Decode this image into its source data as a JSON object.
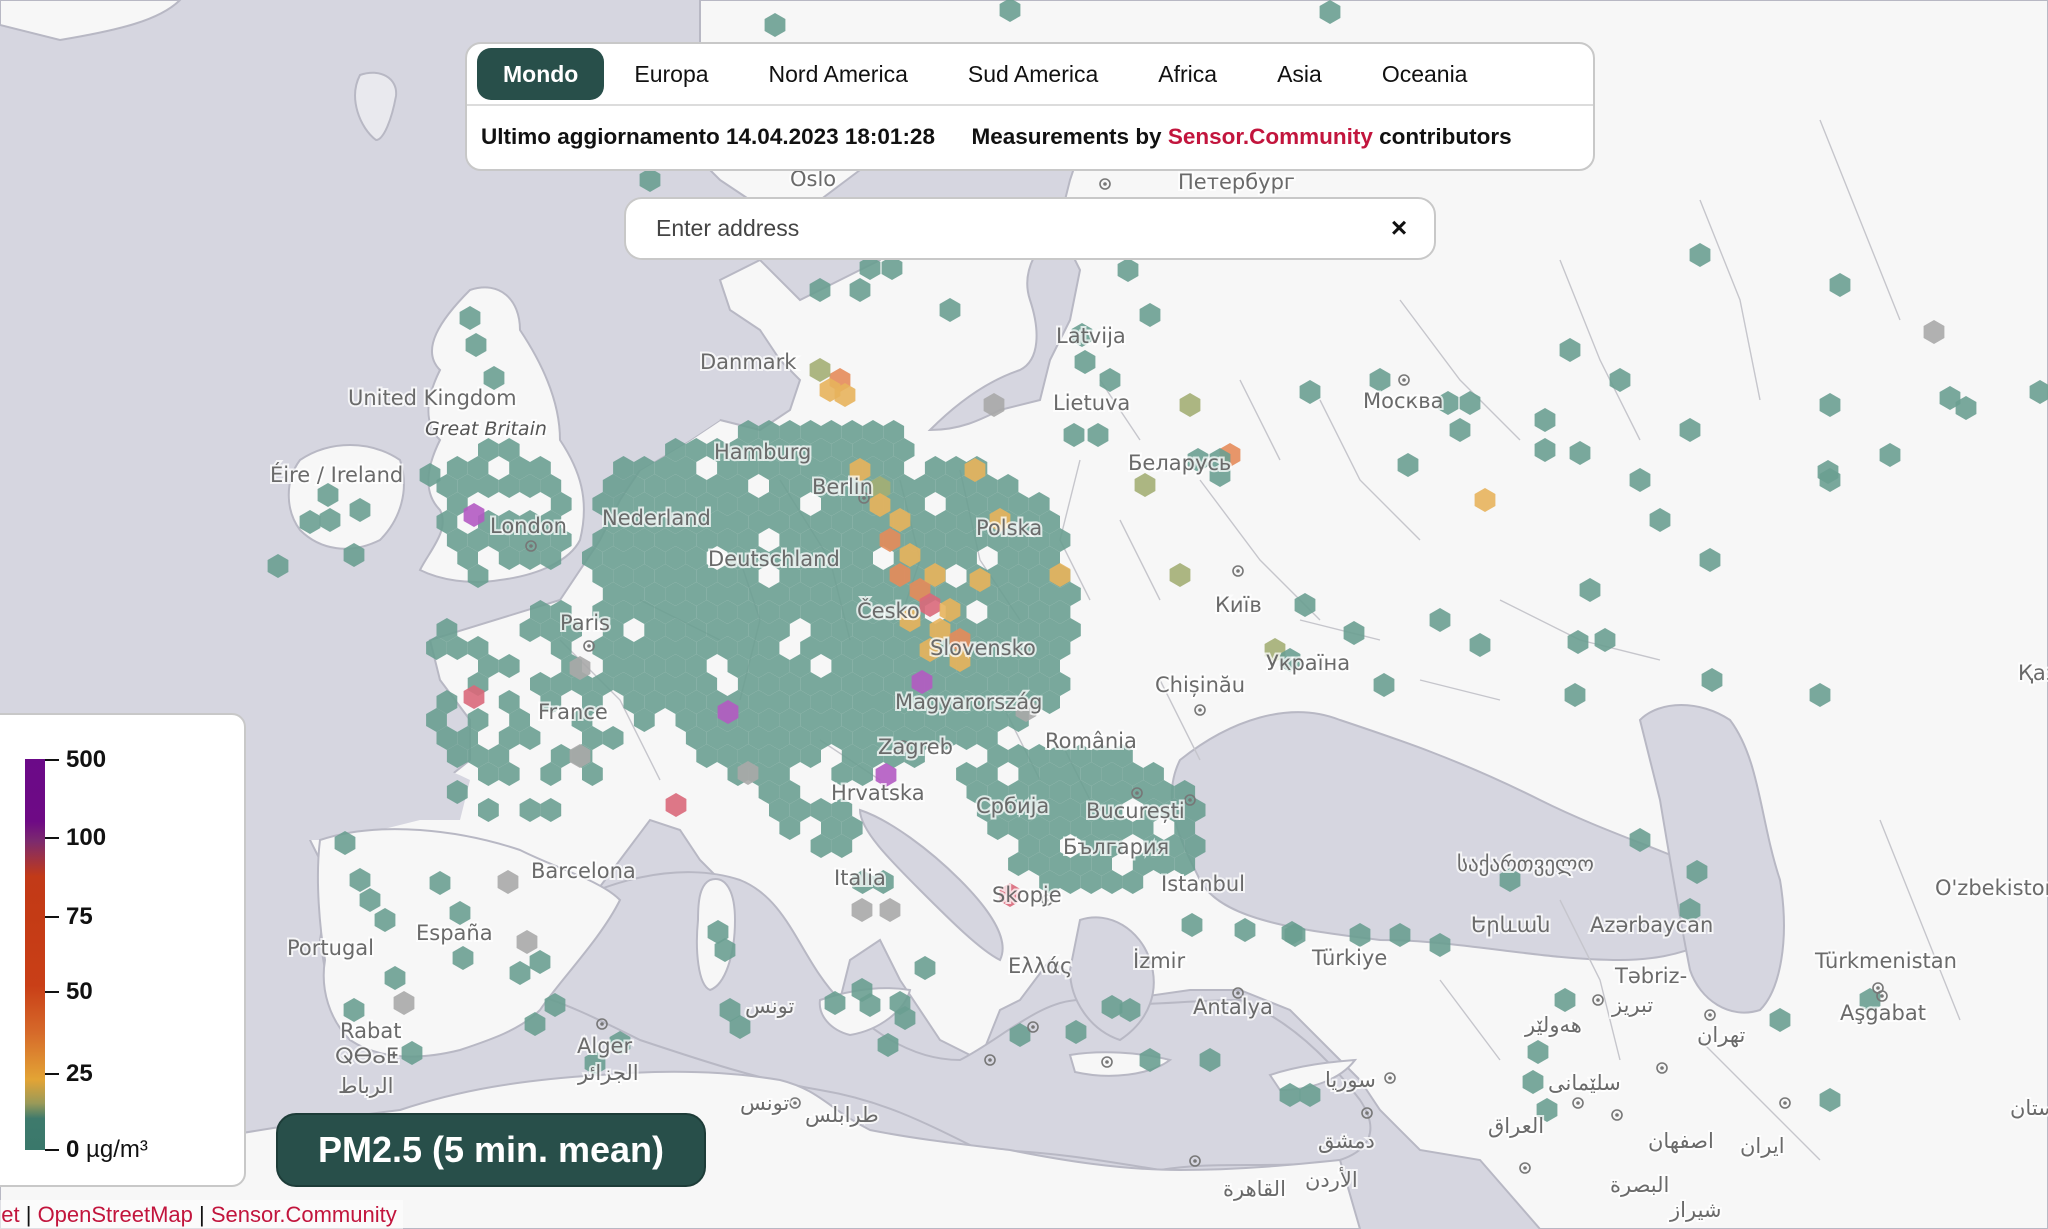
{
  "tabs": [
    {
      "label": "Mondo",
      "active": true
    },
    {
      "label": "Europa",
      "active": false
    },
    {
      "label": "Nord America",
      "active": false
    },
    {
      "label": "Sud America",
      "active": false
    },
    {
      "label": "Africa",
      "active": false
    },
    {
      "label": "Asia",
      "active": false
    },
    {
      "label": "Oceania",
      "active": false
    }
  ],
  "info": {
    "last_update_label": "Ultimo aggiornamento",
    "last_update_value": "14.04.2023 18:01:28",
    "measurements_prefix": "Measurements by",
    "measurements_link": "Sensor.Community",
    "measurements_suffix": "contributors"
  },
  "search": {
    "placeholder": "Enter address",
    "value": "",
    "clear_icon": "×"
  },
  "legend": {
    "ticks": [
      {
        "value": "500",
        "unit": ""
      },
      {
        "value": "100",
        "unit": ""
      },
      {
        "value": "75",
        "unit": ""
      },
      {
        "value": "50",
        "unit": ""
      },
      {
        "value": "25",
        "unit": ""
      },
      {
        "value": "0",
        "unit": "µg/m³"
      }
    ],
    "colors": {
      "low": "#3a786b",
      "moderate": "#e3a435",
      "high": "#c93f17",
      "very_high": "#6b0a88"
    }
  },
  "metric": {
    "label": "PM2.5 (5 min. mean)"
  },
  "attribution": {
    "items": [
      "aflet",
      "OpenStreetMap",
      "Sensor.Community"
    ],
    "separator": "|"
  },
  "colors": {
    "accent": "#284f4a",
    "link": "#c2153d",
    "water": "#d6d6e0",
    "land": "#f7f7f7",
    "hex_low": "#6a9e91",
    "hex_yellow": "#e7b35c",
    "hex_orange": "#e48b5a",
    "hex_red": "#d9687a",
    "hex_purple": "#b25ac2",
    "hex_olive": "#a3ae74",
    "hex_gray": "#a8a8a8"
  },
  "map_labels": [
    {
      "text": "Oslo",
      "style": "normal"
    },
    {
      "text": "Петербург",
      "style": "normal"
    },
    {
      "text": "Danmark",
      "style": "normal"
    },
    {
      "text": "Latvija",
      "style": "normal"
    },
    {
      "text": "United Kingdom",
      "style": "normal"
    },
    {
      "text": "Great Britain",
      "style": "italic"
    },
    {
      "text": "Lietuva",
      "style": "normal"
    },
    {
      "text": "Москва",
      "style": "normal"
    },
    {
      "text": "Éire / Ireland",
      "style": "normal"
    },
    {
      "text": "Hamburg",
      "style": "normal"
    },
    {
      "text": "Беларусь",
      "style": "normal"
    },
    {
      "text": "Berlin",
      "style": "normal"
    },
    {
      "text": "London",
      "style": "normal"
    },
    {
      "text": "Nederland",
      "style": "normal"
    },
    {
      "text": "Polska",
      "style": "normal"
    },
    {
      "text": "Deutschland",
      "style": "normal"
    },
    {
      "text": "Київ",
      "style": "normal"
    },
    {
      "text": "Česko",
      "style": "normal"
    },
    {
      "text": "Paris",
      "style": "normal"
    },
    {
      "text": "Slovensko",
      "style": "normal"
    },
    {
      "text": "Україна",
      "style": "normal"
    },
    {
      "text": "Chișinău",
      "style": "normal"
    },
    {
      "text": "France",
      "style": "normal"
    },
    {
      "text": "Magyarország",
      "style": "normal"
    },
    {
      "text": "Zagreb",
      "style": "normal"
    },
    {
      "text": "România",
      "style": "normal"
    },
    {
      "text": "Hrvatska",
      "style": "normal"
    },
    {
      "text": "Србија",
      "style": "normal"
    },
    {
      "text": "București",
      "style": "normal"
    },
    {
      "text": "България",
      "style": "normal"
    },
    {
      "text": "Barcelona",
      "style": "normal"
    },
    {
      "text": "Italia",
      "style": "normal"
    },
    {
      "text": "Istanbul",
      "style": "normal"
    },
    {
      "text": "საქართველო",
      "style": "normal"
    },
    {
      "text": "Skopje",
      "style": "normal"
    },
    {
      "text": "O'zbekiston",
      "style": "normal"
    },
    {
      "text": "Portugal",
      "style": "normal"
    },
    {
      "text": "España",
      "style": "normal"
    },
    {
      "text": "Երևան",
      "style": "normal"
    },
    {
      "text": "Azərbaycan",
      "style": "normal"
    },
    {
      "text": "Ελλάς",
      "style": "normal"
    },
    {
      "text": "İzmir",
      "style": "normal"
    },
    {
      "text": "Türkiye",
      "style": "normal"
    },
    {
      "text": "Türkmenistan",
      "style": "normal"
    },
    {
      "text": "Təbriz-",
      "style": "normal"
    },
    {
      "text": "تبریز",
      "style": "normal"
    },
    {
      "text": "Antalya",
      "style": "normal"
    },
    {
      "text": "Aşgabat",
      "style": "normal"
    },
    {
      "text": "Rabat",
      "style": "normal"
    },
    {
      "text": "ⵕⴱⴰⵟ",
      "style": "normal"
    },
    {
      "text": "الرباط",
      "style": "normal"
    },
    {
      "text": "Alger",
      "style": "normal"
    },
    {
      "text": "الجزائر",
      "style": "normal"
    },
    {
      "text": "تونس",
      "style": "normal"
    },
    {
      "text": "هەولێر",
      "style": "normal"
    },
    {
      "text": "تهران",
      "style": "normal"
    },
    {
      "text": "سوريا",
      "style": "normal"
    },
    {
      "text": "سلێمانی",
      "style": "normal"
    },
    {
      "text": "تونس",
      "style": "normal"
    },
    {
      "text": "طرابلس",
      "style": "normal"
    },
    {
      "text": "العراق",
      "style": "normal"
    },
    {
      "text": "دمشق",
      "style": "normal"
    },
    {
      "text": "اصفهان",
      "style": "normal"
    },
    {
      "text": "ایران",
      "style": "normal"
    },
    {
      "text": "الأردن",
      "style": "normal"
    },
    {
      "text": "البصرة",
      "style": "normal"
    },
    {
      "text": "القاهرة",
      "style": "normal"
    },
    {
      "text": "شیراز",
      "style": "normal"
    },
    {
      "text": "Қаз",
      "style": "normal"
    },
    {
      "text": "ستان",
      "style": "normal"
    }
  ]
}
